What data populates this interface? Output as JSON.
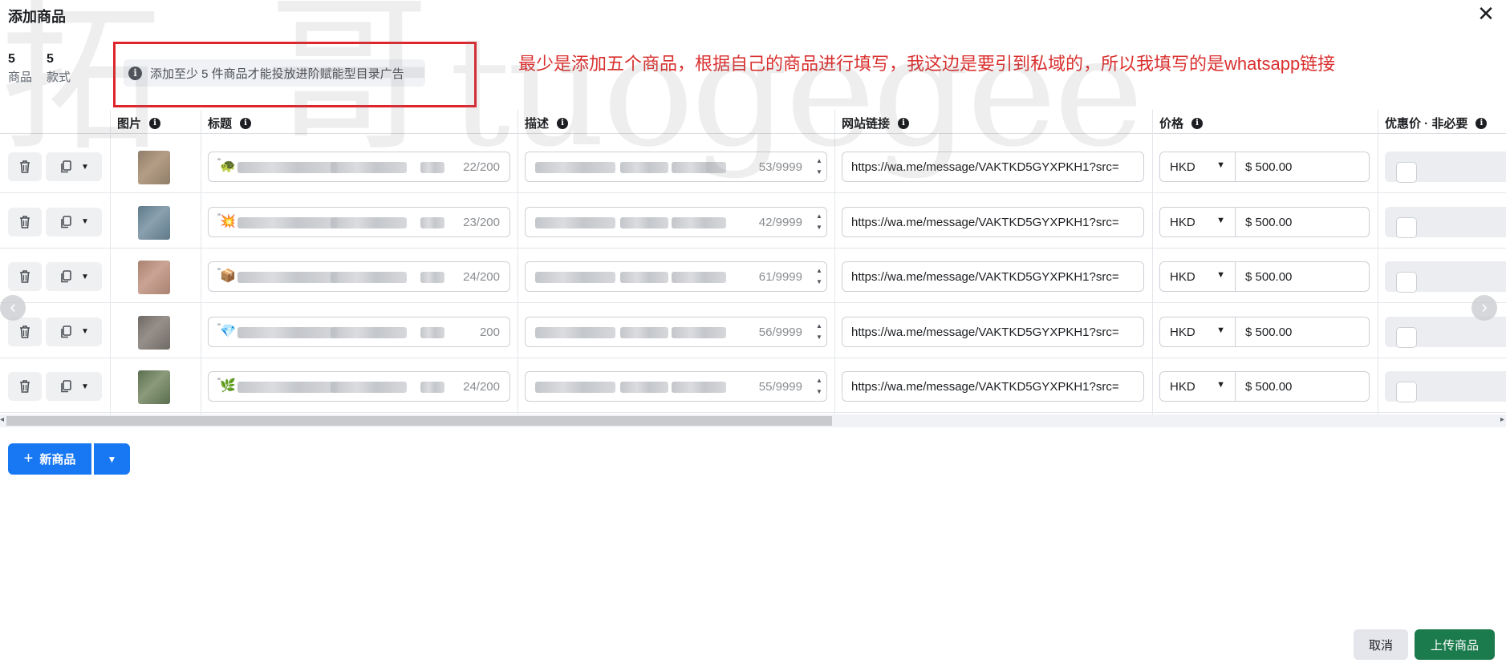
{
  "dialog": {
    "title": "添加商品",
    "close_icon": "close-icon"
  },
  "stats": [
    {
      "value": "5",
      "label": "商品"
    },
    {
      "value": "5",
      "label": "款式"
    }
  ],
  "notice": {
    "icon": "info-icon",
    "text": "添加至少 5 件商品才能投放进阶赋能型目录广告"
  },
  "annotation": {
    "text": "最少是添加五个商品，根据自己的商品进行填写，我这边是要引到私域的，所以我填写的是whatsapp链接",
    "color": "#d9302f"
  },
  "watermark": {
    "text": "tuogegee",
    "char1": "拓",
    "char2": "哥"
  },
  "columns": {
    "image": "图片",
    "title": "标题",
    "description": "描述",
    "url": "网站链接",
    "price": "价格",
    "sale_price": "优惠价 · 非必要"
  },
  "rows": [
    {
      "title_emoji": "🐢",
      "title_count": "22/200",
      "desc_count": "53/9999",
      "url": "https://wa.me/message/VAKTKD5GYXPKH1?src=",
      "currency": "HKD",
      "price": "$ 500.00"
    },
    {
      "title_emoji": "💥",
      "title_count": "23/200",
      "desc_count": "42/9999",
      "url": "https://wa.me/message/VAKTKD5GYXPKH1?src=",
      "currency": "HKD",
      "price": "$ 500.00"
    },
    {
      "title_emoji": "📦",
      "title_count": "24/200",
      "desc_count": "61/9999",
      "url": "https://wa.me/message/VAKTKD5GYXPKH1?src=",
      "currency": "HKD",
      "price": "$ 500.00"
    },
    {
      "title_emoji": "💎",
      "title_count": "200",
      "desc_count": "56/9999",
      "url": "https://wa.me/message/VAKTKD5GYXPKH1?src=",
      "currency": "HKD",
      "price": "$ 500.00"
    },
    {
      "title_emoji": "🌿",
      "title_count": "24/200",
      "desc_count": "55/9999",
      "url": "https://wa.me/message/VAKTKD5GYXPKH1?src=",
      "currency": "HKD",
      "price": "$ 500.00"
    }
  ],
  "actions": {
    "new_product": "新商品",
    "cancel": "取消",
    "upload": "上传商品"
  },
  "colors": {
    "primary_blue": "#1877f2",
    "upload_green": "#1b7b4c",
    "highlight_red": "#e0242c"
  }
}
